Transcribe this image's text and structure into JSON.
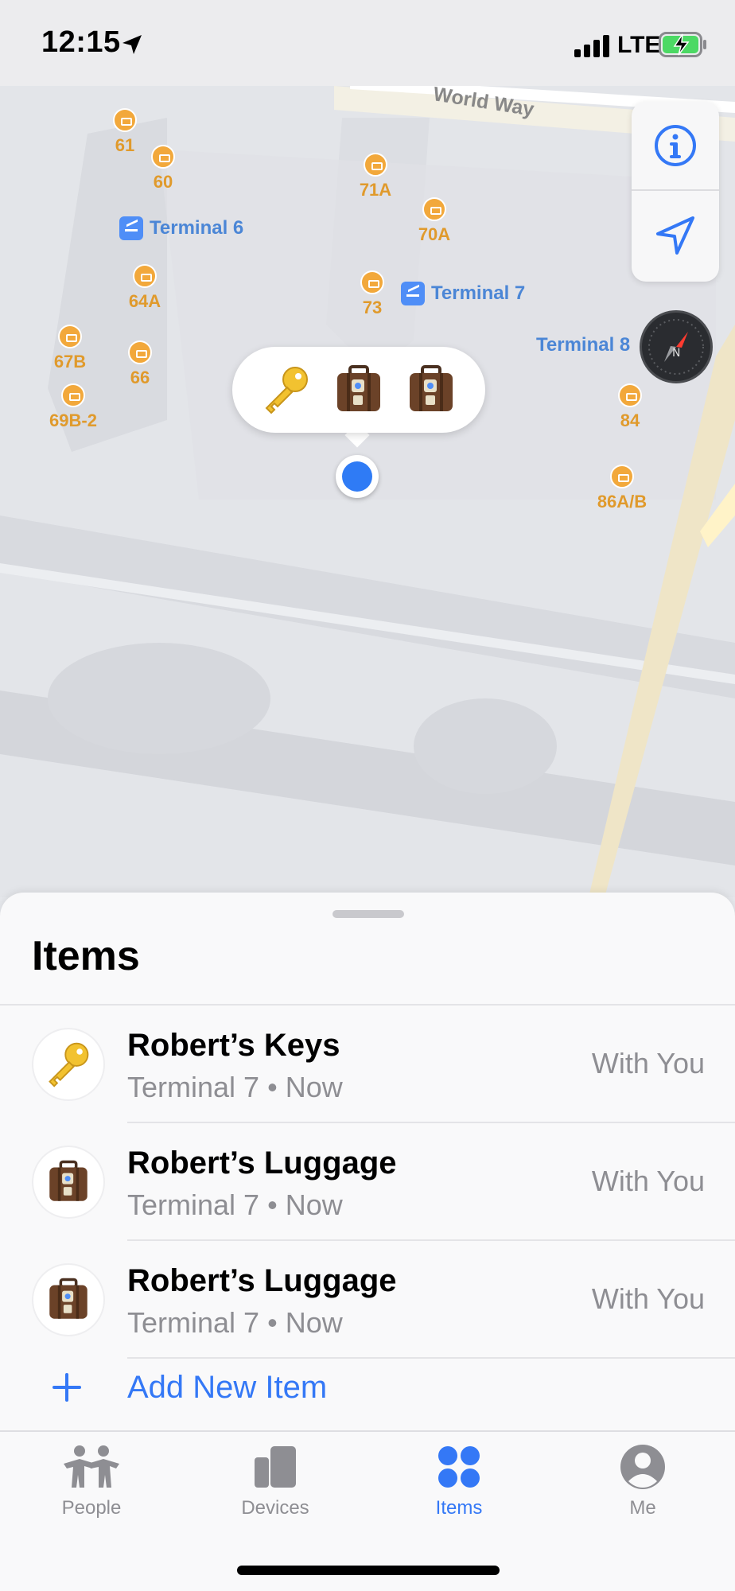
{
  "status_bar": {
    "time": "12:15",
    "network": "LTE"
  },
  "map": {
    "road": "World Way",
    "terminals": [
      "Terminal 6",
      "Terminal 7",
      "Terminal 8"
    ],
    "gates": [
      "61",
      "60",
      "71A",
      "70A",
      "64A",
      "73",
      "67B",
      "66",
      "69B-2",
      "84",
      "86A/B"
    ],
    "cluster_icons": [
      "key-emoji",
      "luggage-emoji",
      "luggage-emoji"
    ],
    "accent_color": "#3478f6"
  },
  "sheet": {
    "title": "Items",
    "items": [
      {
        "name": "Robert’s Keys",
        "location": "Terminal 7",
        "time": "Now",
        "status": "With You",
        "icon": "key-emoji"
      },
      {
        "name": "Robert’s Luggage",
        "location": "Terminal 7",
        "time": "Now",
        "status": "With You",
        "icon": "luggage-emoji"
      },
      {
        "name": "Robert’s Luggage",
        "location": "Terminal 7",
        "time": "Now",
        "status": "With You",
        "icon": "luggage-emoji"
      }
    ],
    "separator": "•",
    "add_label": "Add New Item"
  },
  "tabbar": {
    "tabs": [
      {
        "label": "People",
        "icon": "people-icon"
      },
      {
        "label": "Devices",
        "icon": "devices-icon"
      },
      {
        "label": "Items",
        "icon": "items-icon"
      },
      {
        "label": "Me",
        "icon": "me-icon"
      }
    ],
    "active": "Items"
  }
}
